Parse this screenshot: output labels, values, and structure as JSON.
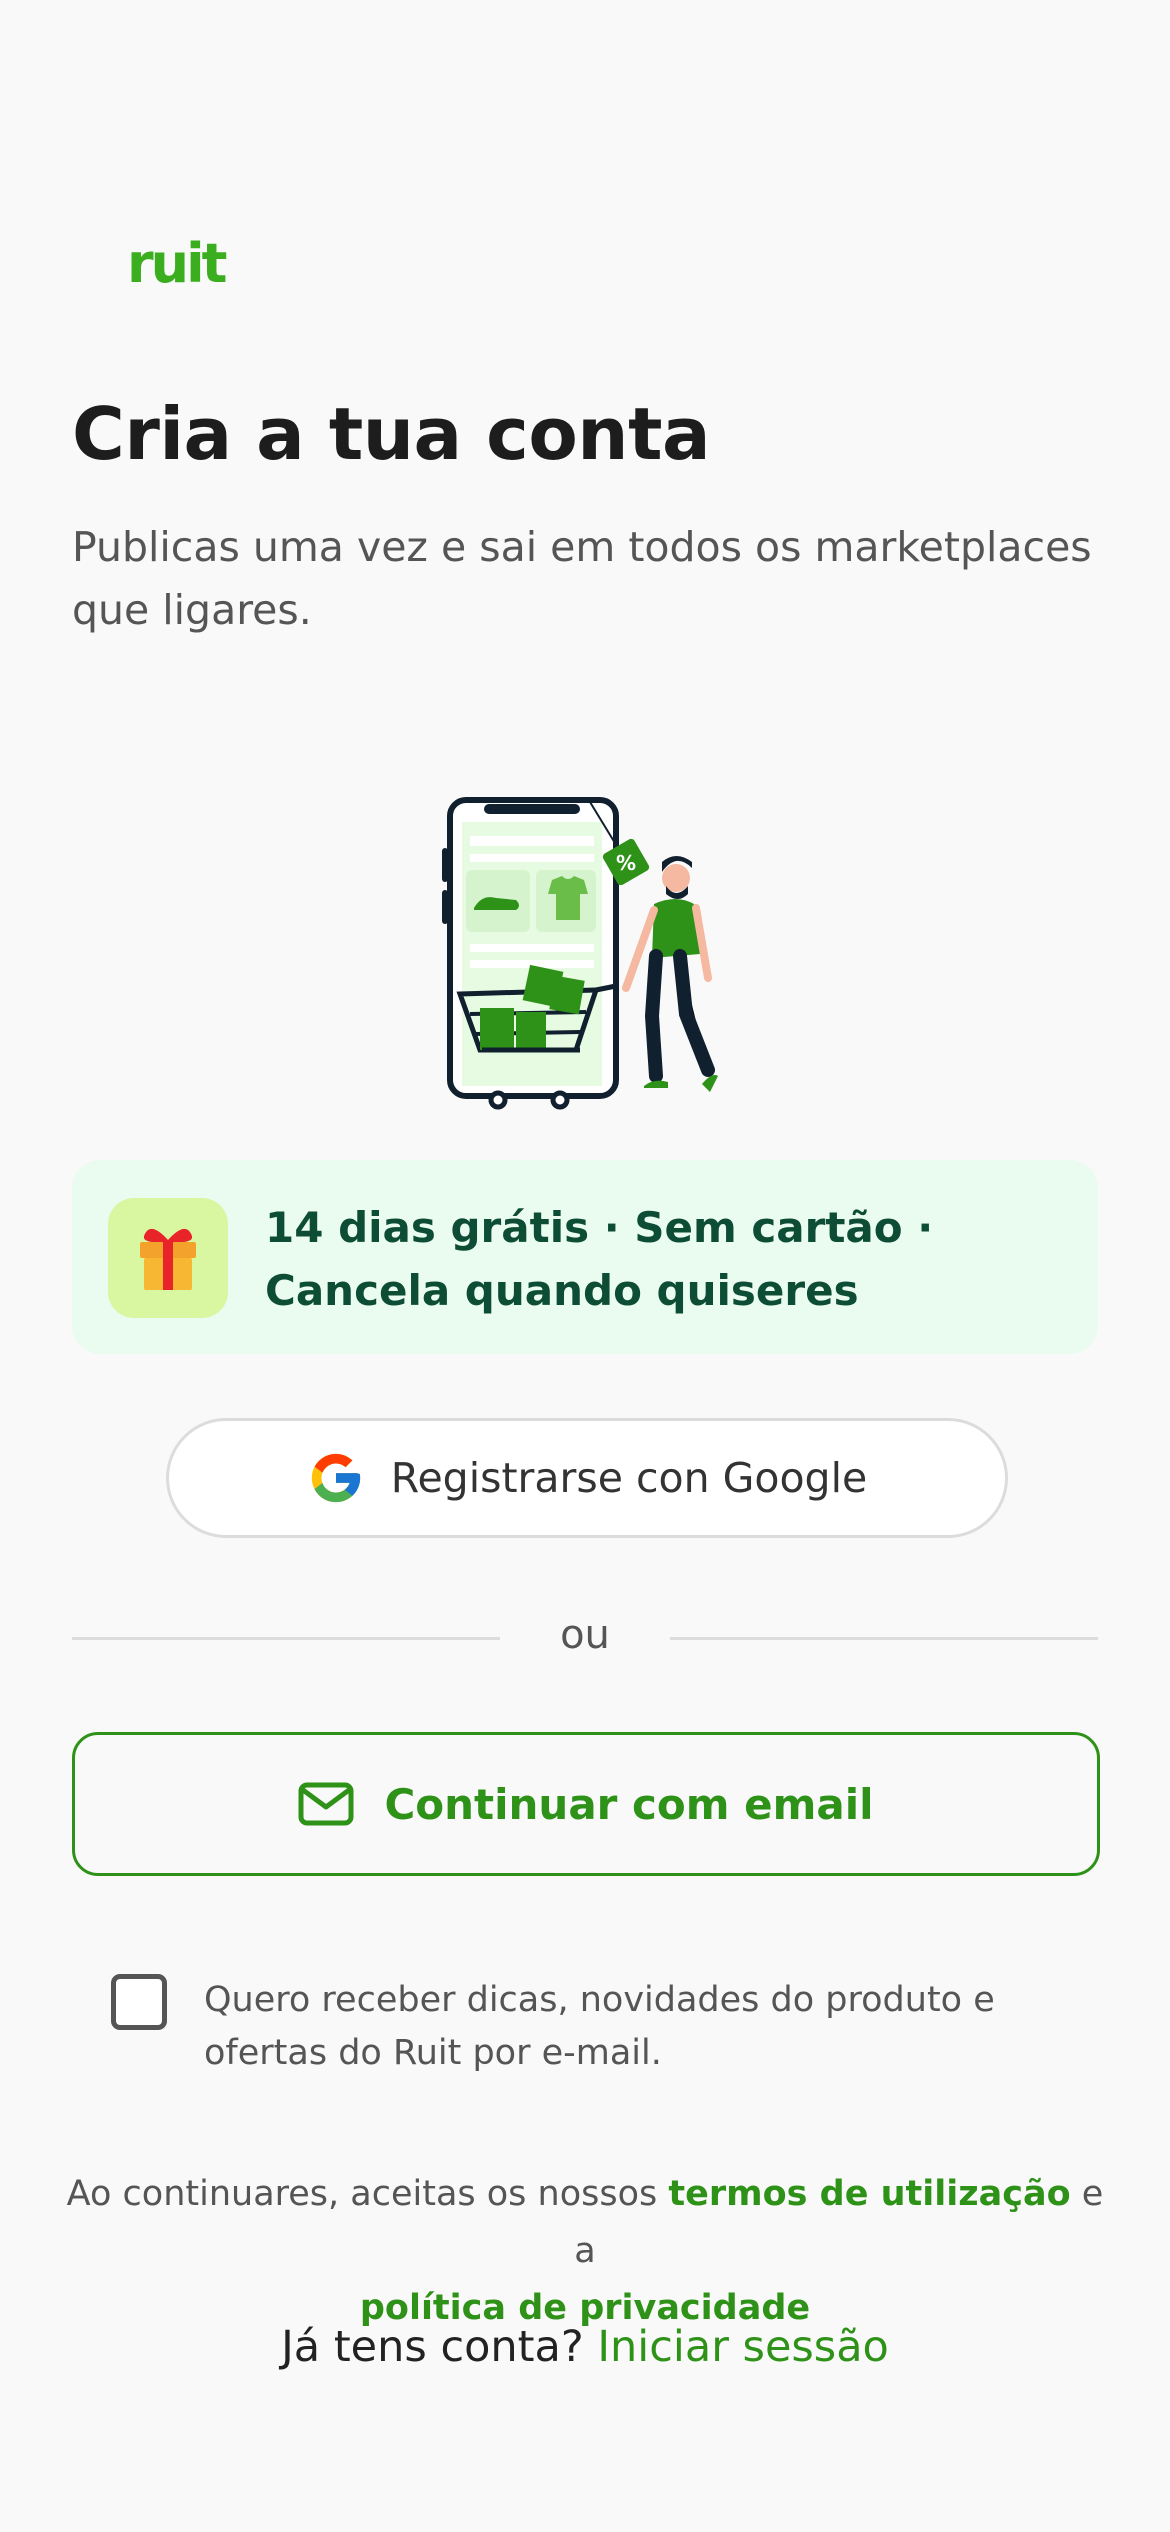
{
  "brand": {
    "logo_text": "ruit",
    "accent_color": "#3aae1f",
    "link_color": "#2f9218"
  },
  "header": {
    "title": "Cria a tua conta",
    "subtitle": "Publicas uma vez e sai em todos os marketplaces que ligares."
  },
  "promo": {
    "icon": "gift-icon",
    "text": "14 dias grátis · Sem cartão · Cancela quando quiseres"
  },
  "google_button": {
    "icon": "google-icon",
    "label": "Registrarse con Google"
  },
  "divider": {
    "text": "ou"
  },
  "email_button": {
    "icon": "mail-icon",
    "label": "Continuar com email"
  },
  "newsletter": {
    "checked": false,
    "label": "Quero receber dicas, novidades do produto e ofertas do Ruit por e-mail."
  },
  "terms": {
    "prefix": "Ao continuares, aceitas os nossos ",
    "terms_link": "termos de utilização",
    "middle": " e a ",
    "privacy_link": "política de privacidade"
  },
  "login": {
    "prompt": "Já tens conta? ",
    "link": "Iniciar sessão"
  }
}
